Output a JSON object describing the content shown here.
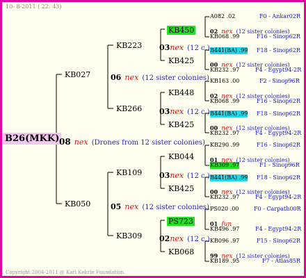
{
  "header": {
    "date": "10- 8-2011 ( 22: 43)"
  },
  "footer": {
    "copyright": "Copyright 2004-2011 @ Karl Kehrle Foundation."
  },
  "root": {
    "name": "B26(MKK)"
  },
  "g1": {
    "num": "08",
    "nex": "nex",
    "note": "(Drones from 12 sister colonies)"
  },
  "p1": {
    "name": "KB027",
    "num": "06",
    "nex": "nex",
    "note": "(12 sister colonies)"
  },
  "p2": {
    "name": "KB050",
    "num": "05",
    "nex": "nex",
    "note": "(12 sister colonies)"
  },
  "gp": [
    {
      "name": "KB223",
      "num": "03",
      "nex": "nex",
      "note": "(12 c.)"
    },
    {
      "name": "KB266",
      "num": "03",
      "nex": "nex",
      "note": "(12 c.)"
    },
    {
      "name": "KB109",
      "num": "03",
      "nex": "nex",
      "note": "(12 c.)"
    },
    {
      "name": "KB309",
      "num": "02",
      "nex": "nex",
      "note": "(12 c.)"
    }
  ],
  "ggp": [
    "KB450",
    "KB425",
    "KB448",
    "KB425",
    "KB044",
    "KB425",
    "PS723",
    "KB068"
  ],
  "col4": [
    {
      "a": "A082 .02",
      "aloc": "F0 - Ankar02R",
      "num": "02",
      "nex": "nex",
      "note": "(12 sister colonies)",
      "b": "KB068 .99",
      "bloc": "F16 - Sinop62R"
    },
    {
      "a": "B441(BA) .99",
      "aloc": "F18 - Sinop62R",
      "num": "00",
      "nex": "nex",
      "note": "(12 sister colonies)",
      "b": "KB232 .97",
      "bloc": "F4 - Egypt94-2R"
    },
    {
      "a": "KB163 .00",
      "aloc": "F2 - Sinop96R",
      "num": "02",
      "nex": "nex",
      "note": "(12 sister colonies)",
      "b": "KB068 .99",
      "bloc": "F16 - Sinop62R"
    },
    {
      "a": "B441(BA) .99",
      "aloc": "F18 - Sinop62R",
      "num": "00",
      "nex": "nex",
      "note": "(12 sister colonies)",
      "b": "KB232 .97",
      "bloc": "F4 - Egypt94-2R"
    },
    {
      "a": "KB290 .99",
      "aloc": "F16 - Sinop62R",
      "num": "01",
      "nex": "nex",
      "note": "(12 sister colonies)",
      "b": "KB309 .97",
      "bloc": "F1 - Sinop96R"
    },
    {
      "a": "B441(BA) .99",
      "aloc": "F18 - Sinop62R",
      "num": "00",
      "nex": "nex",
      "note": "(12 sister colonies)",
      "b": "KB232 .97",
      "bloc": "F4 - Egypt94-2R"
    },
    {
      "a": "PS020 .00",
      "aloc": "F0 - Carpath00R",
      "num": "01",
      "nex": "fun",
      "note": "",
      "b": "KB496 .97",
      "bloc": "F4 - Egypt94-2R"
    },
    {
      "a": "KB096 .97",
      "aloc": "F15 - Sinop62R",
      "num": "99",
      "nex": "nex",
      "note": "(12 sister colonies)",
      "b": "KB189 .95",
      "bloc": "F7 - Atlas85R"
    }
  ]
}
